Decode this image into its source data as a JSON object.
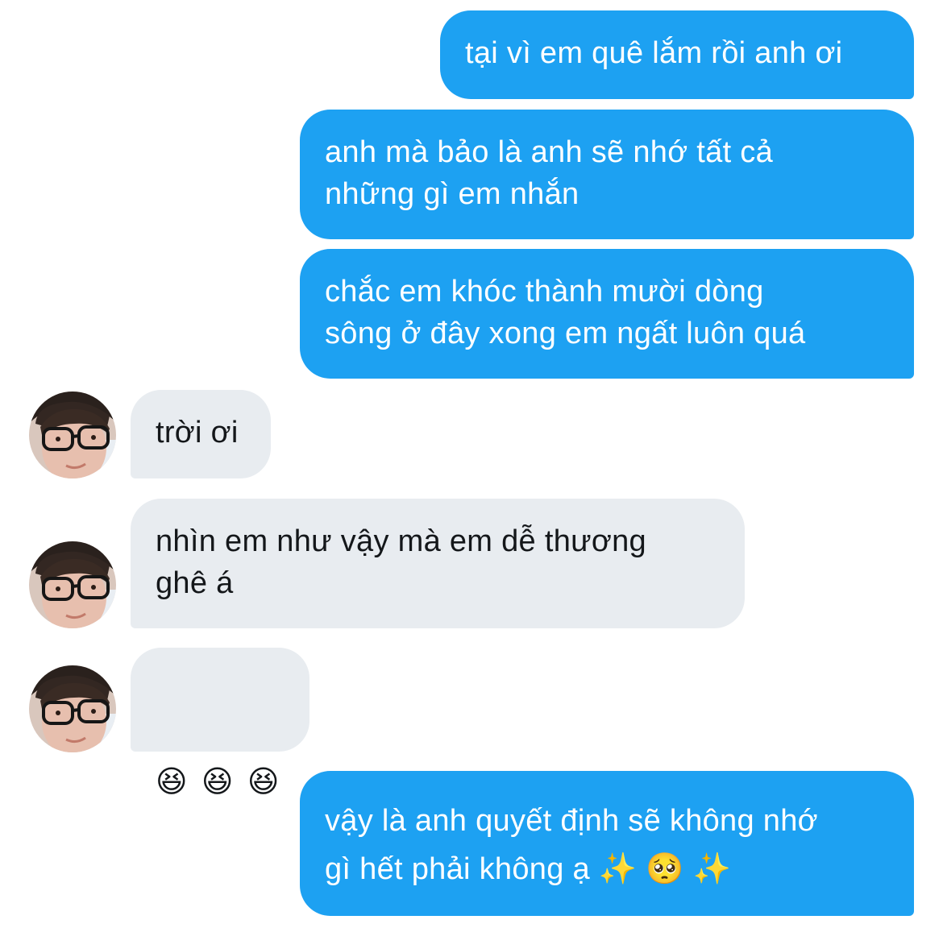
{
  "messages": [
    {
      "direction": "outgoing",
      "text": "tại vì em quê lắm rồi anh ơi"
    },
    {
      "direction": "outgoing",
      "text": "anh mà bảo là anh sẽ nhớ tất cả\nnhững gì em nhắn"
    },
    {
      "direction": "outgoing",
      "text": "chắc em khóc thành mười dòng\nsông ở đây xong em ngất luôn quá"
    },
    {
      "direction": "incoming",
      "text": "trời ơi"
    },
    {
      "direction": "incoming",
      "text": "nhìn em như vậy mà em dễ thương\nghê á"
    },
    {
      "direction": "incoming",
      "emojis": [
        "😆",
        "😆",
        "😆"
      ]
    },
    {
      "direction": "outgoing",
      "text": "vậy là anh quyết định sẽ không nhớ\ngì hết phải không ạ ✨ 🥺 ✨"
    }
  ],
  "colors": {
    "outgoing_bubble": "#1da1f2",
    "incoming_bubble": "#e8ecf0",
    "incoming_text": "#14171a",
    "outgoing_text": "#ffffff"
  },
  "icons": {
    "avatar": "contact-avatar-photo"
  }
}
